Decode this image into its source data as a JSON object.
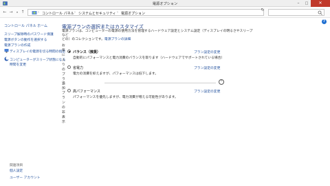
{
  "window": {
    "title": "電源オプション"
  },
  "address": {
    "crumbs": [
      "コントロール パネル",
      "システムとセキュリティ",
      "電源オプション"
    ],
    "search_placeholder": ""
  },
  "sidebar": {
    "home": "コントロール パネル ホーム",
    "links": [
      "スリープ解除時のパスワード保護",
      "電源ボタンの動作を選択する",
      "電源プランの作成",
      "ディスプレイの電源を切る時間の指定",
      "コンピューターがスリープ状態になる",
      "時間を変更"
    ],
    "related_heading": "関連項目",
    "related": [
      "個人設定",
      "ユーザー アカウント"
    ]
  },
  "main": {
    "heading": "電源プランの選択またはカスタマイズ",
    "desc_line1": "電源プランは、コンピューターの電源の使用方法を管理するハードウェア設定とシステム設定（ディスプレイの明るさやスリープなど",
    "desc_line2_prefix": "どの）のコレクションです。",
    "desc_link": "電源プランの詳細",
    "preferred_heading": "お気に入りのプラン",
    "plans": [
      {
        "name": "バランス（推奨）",
        "desc": "自動的にパフォーマンスと電力消費のバランスを取ります（ハードウェアでサポートされている場合）",
        "link": "プラン設定の変更",
        "selected": true
      },
      {
        "name": "省電力",
        "desc": "電力の消費を抑えますが、パフォーマンスは低下します。",
        "link": "プラン設定の変更",
        "selected": false
      }
    ],
    "additional_heading": "追加プランの非表示",
    "extra_plans": [
      {
        "name": "高パフォーマンス",
        "desc": "パフォーマンスを優先しますが、電力消費が増える可能性があります。",
        "link": "プラン設定の変更",
        "selected": false
      }
    ]
  }
}
